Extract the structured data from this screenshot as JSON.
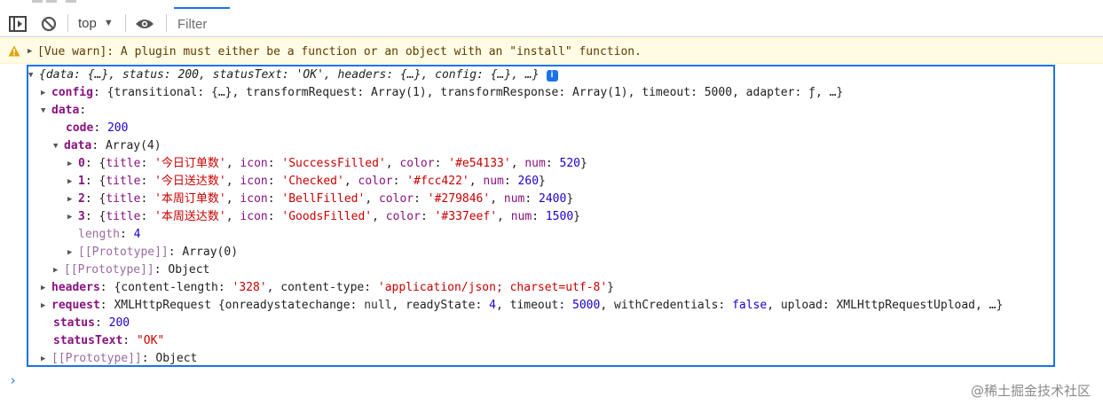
{
  "toolbar": {
    "context": "top",
    "filter_placeholder": "Filter"
  },
  "warning": {
    "text": "[Vue warn]: A plugin must either be a function or an object with an \"install\" function."
  },
  "log": {
    "summary": "{data: {…}, status: 200, statusText: 'OK', headers: {…}, config: {…}, …}",
    "info_badge": "i",
    "config_key": "config",
    "config_value": "{transitional: {…}, transformRequest: Array(1), transformResponse: Array(1), timeout: 5000, adapter: ƒ, …}",
    "data_key": "data",
    "code_key": "code",
    "code_value": "200",
    "inner_data_key": "data",
    "inner_data_value": "Array(4)",
    "items": [
      {
        "index": "0",
        "title": "'今日订单数'",
        "icon": "'SuccessFilled'",
        "color": "'#e54133'",
        "num": "520"
      },
      {
        "index": "1",
        "title": "'今日送达数'",
        "icon": "'Checked'",
        "color": "'#fcc422'",
        "num": "260"
      },
      {
        "index": "2",
        "title": "'本周订单数'",
        "icon": "'BellFilled'",
        "color": "'#279846'",
        "num": "2400"
      },
      {
        "index": "3",
        "title": "'本周送达数'",
        "icon": "'GoodsFilled'",
        "color": "'#337eef'",
        "num": "1500"
      }
    ],
    "length_key": "length",
    "length_value": "4",
    "proto_key": "[[Prototype]]",
    "proto_array": "Array(0)",
    "proto_object": "Object",
    "headers_key": "headers",
    "headers_value_pre": "{content-length: ",
    "headers_len": "'328'",
    "headers_mid": ", content-type: ",
    "headers_type": "'application/json; charset=utf-8'",
    "headers_end": "}",
    "request_key": "request",
    "request_value_pre": "XMLHttpRequest {onreadystatechange: ",
    "request_null": "null",
    "request_rs": ", readyState: ",
    "request_rs_val": "4",
    "request_to": ", timeout: ",
    "request_to_val": "5000",
    "request_wc": ", withCredentials: ",
    "request_wc_val": "false",
    "request_up": ", upload: XMLHttpRequestUpload, …}",
    "status_key": "status",
    "status_value": "200",
    "statustext_key": "statusText",
    "statustext_value": "\"OK\""
  },
  "watermark": "@稀土掘金技术社区"
}
